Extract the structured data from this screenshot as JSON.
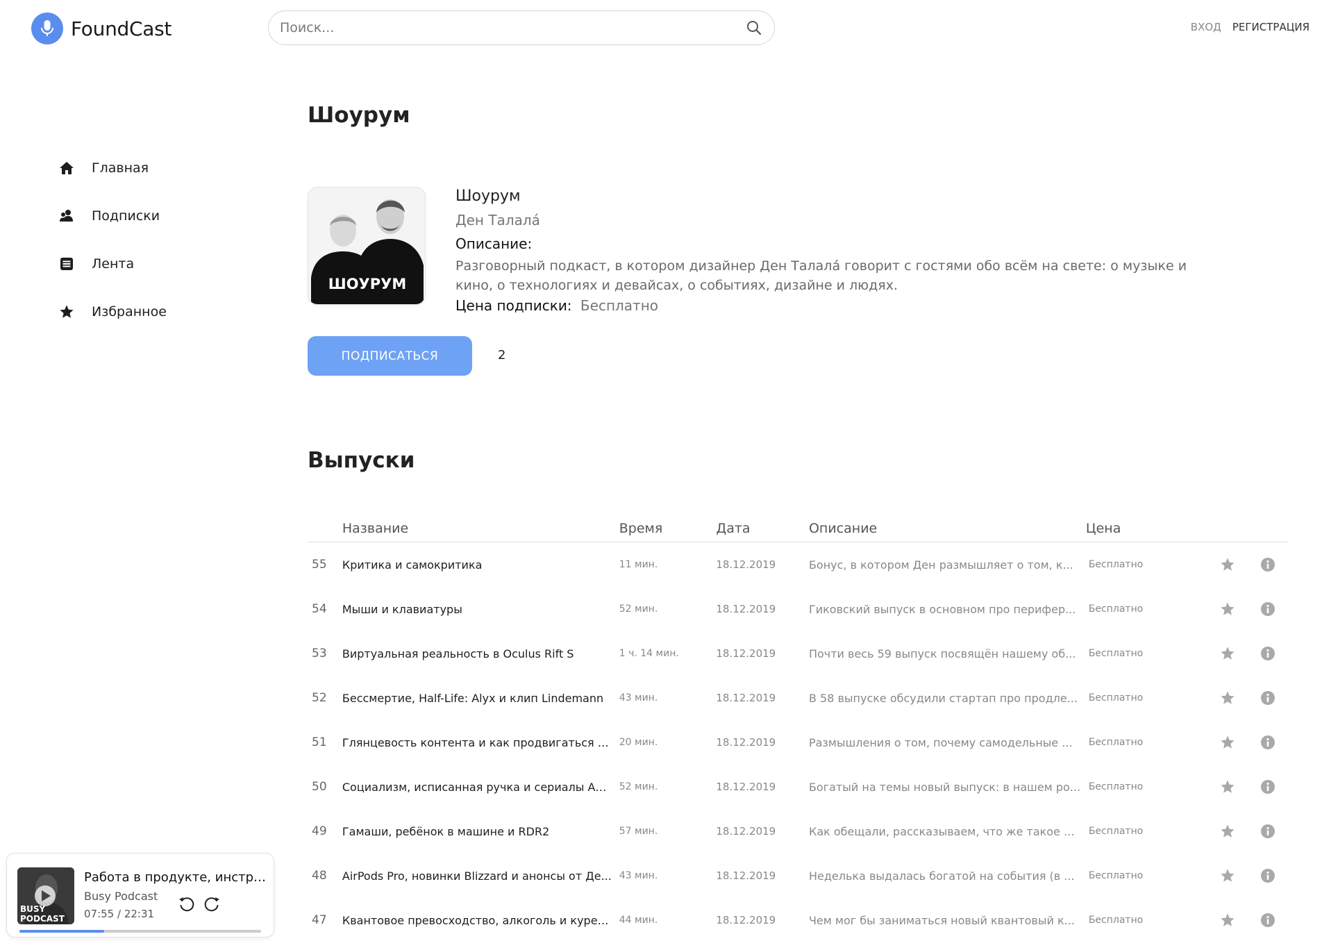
{
  "app": {
    "name": "FoundCast",
    "accent": "#5b8def"
  },
  "search": {
    "placeholder": "Поиск..."
  },
  "auth": {
    "login": "ВХОД",
    "register": "РЕГИСТРАЦИЯ"
  },
  "nav": [
    {
      "label": "Главная",
      "icon": "home-icon"
    },
    {
      "label": "Подписки",
      "icon": "users-icon"
    },
    {
      "label": "Лента",
      "icon": "feed-icon"
    },
    {
      "label": "Избранное",
      "icon": "star-icon"
    }
  ],
  "podcast": {
    "page_title": "Шоурум",
    "name": "Шоурум",
    "author": "Ден Талала́",
    "cover_text": "ШОУРУМ",
    "description_label": "Описание:",
    "description": "Разговорный подкаст, в котором дизайнер Ден Талала́ говорит с гостями обо всём на свете: о музыке и кино, о технологиях и девайсах, о событиях, дизайне и людях.",
    "price_label": "Цена подписки:",
    "price_value": "Бесплатно",
    "subscribe_label": "ПОДПИСАТЬСЯ",
    "subscriber_count": "2"
  },
  "episodes": {
    "section_title": "Выпуски",
    "columns": {
      "title": "Название",
      "time": "Время",
      "date": "Дата",
      "description": "Описание",
      "price": "Цена"
    },
    "rows": [
      {
        "num": "55",
        "title": "Критика и самокритика",
        "time": "11 мин.",
        "date": "18.12.2019",
        "description": "Бонус, в котором Ден размышляет о том, к...",
        "price": "Бесплатно"
      },
      {
        "num": "54",
        "title": "Мыши и клавиатуры",
        "time": "52 мин.",
        "date": "18.12.2019",
        "description": "Гиковский выпуск в основном про перифер...",
        "price": "Бесплатно"
      },
      {
        "num": "53",
        "title": "Виртуальная реальность в Oculus Rift S",
        "time": "1 ч. 14 мин.",
        "date": "18.12.2019",
        "description": "Почти весь 59 выпуск посвящён нашему об...",
        "price": "Бесплатно"
      },
      {
        "num": "52",
        "title": "Бессмертие, Half-Life: Alyx и клип Lindemann",
        "time": "43 мин.",
        "date": "18.12.2019",
        "description": "В 58 выпуске обсудили стартап про продле...",
        "price": "Бесплатно"
      },
      {
        "num": "51",
        "title": "Глянцевость контента и как продвигаться в ...",
        "time": "20 мин.",
        "date": "18.12.2019",
        "description": "Размышления о том, почему самодельные ...",
        "price": "Бесплатно"
      },
      {
        "num": "50",
        "title": "Социализм, исписанная ручка и сериалы Ap...",
        "time": "52 мин.",
        "date": "18.12.2019",
        "description": "Богатый на темы новый выпуск: в нашем ро...",
        "price": "Бесплатно"
      },
      {
        "num": "49",
        "title": "Гамаши, ребёнок в машине и RDR2",
        "time": "57 мин.",
        "date": "18.12.2019",
        "description": "Как обещали, рассказываем, что же такое ...",
        "price": "Бесплатно"
      },
      {
        "num": "48",
        "title": "AirPods Pro, новинки Blizzard и анонсы от Де...",
        "time": "43 мин.",
        "date": "18.12.2019",
        "description": "Неделька выдалась богатой на события (в ...",
        "price": "Бесплатно"
      },
      {
        "num": "47",
        "title": "Квантовое превосходство, алкоголь и курен...",
        "time": "44 мин.",
        "date": "18.12.2019",
        "description": "Чем мог бы заниматься новый квантовый к...",
        "price": "Бесплатно"
      }
    ]
  },
  "player": {
    "title": "Работа в продукте, инструменты и ...",
    "podcast": "Busy Podcast",
    "time": "07:55 / 22:31",
    "cover_text_1": "BUSY",
    "cover_text_2": "PODCAST",
    "progress": 0.35
  }
}
